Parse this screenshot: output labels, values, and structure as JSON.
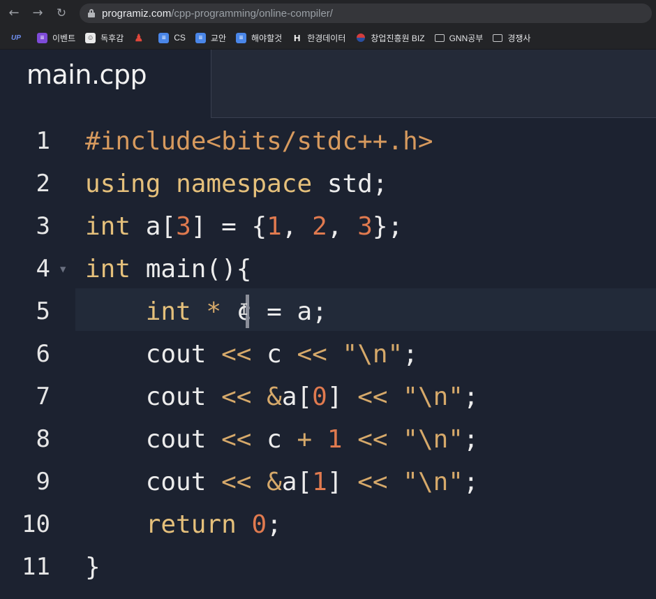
{
  "browser": {
    "back_icon": "back-arrow-icon",
    "forward_icon": "forward-arrow-icon",
    "reload_icon": "reload-icon",
    "url_host": "programiz.com",
    "url_path": "/cpp-programming/online-compiler/"
  },
  "bookmarks": [
    {
      "label": "",
      "icon": "up-icon"
    },
    {
      "label": "이벤트",
      "icon": "list-icon"
    },
    {
      "label": "독후감",
      "icon": "chat-icon"
    },
    {
      "label": "",
      "icon": "person-icon"
    },
    {
      "label": "CS",
      "icon": "doc-icon"
    },
    {
      "label": "교안",
      "icon": "doc-icon"
    },
    {
      "label": "해야할것",
      "icon": "doc-icon"
    },
    {
      "label": "한경데이터",
      "icon": "h-icon"
    },
    {
      "label": "창업진흥원 BIZ",
      "icon": "korea-icon"
    },
    {
      "label": "GNN공부",
      "icon": "folder-icon"
    },
    {
      "label": "경쟁사",
      "icon": "folder-icon"
    }
  ],
  "editor": {
    "tab_title": "main.cpp",
    "line_numbers": [
      "1",
      "2",
      "3",
      "4",
      "5",
      "6",
      "7",
      "8",
      "9",
      "10",
      "11"
    ],
    "lines": [
      [
        {
          "t": "#include",
          "c": "t-inc"
        },
        {
          "t": "<bits/stdc++.h>",
          "c": "t-inc"
        }
      ],
      [
        {
          "t": "using",
          "c": "t-kw"
        },
        {
          "t": " ",
          "c": "t-plain"
        },
        {
          "t": "namespace",
          "c": "t-kw"
        },
        {
          "t": " std;",
          "c": "t-plain"
        }
      ],
      [
        {
          "t": "int",
          "c": "t-kw"
        },
        {
          "t": " a[",
          "c": "t-plain"
        },
        {
          "t": "3",
          "c": "t-num"
        },
        {
          "t": "] = {",
          "c": "t-plain"
        },
        {
          "t": "1",
          "c": "t-num"
        },
        {
          "t": ", ",
          "c": "t-plain"
        },
        {
          "t": "2",
          "c": "t-num"
        },
        {
          "t": ", ",
          "c": "t-plain"
        },
        {
          "t": "3",
          "c": "t-num"
        },
        {
          "t": "};",
          "c": "t-plain"
        }
      ],
      [
        {
          "t": "int",
          "c": "t-kw"
        },
        {
          "t": " main(){",
          "c": "t-plain"
        }
      ],
      [
        {
          "t": "    ",
          "c": "t-plain"
        },
        {
          "t": "int",
          "c": "t-kw"
        },
        {
          "t": " * ",
          "c": "t-op"
        },
        {
          "t": "c = a;",
          "c": "t-plain"
        }
      ],
      [
        {
          "t": "    cout ",
          "c": "t-plain"
        },
        {
          "t": "<<",
          "c": "t-op"
        },
        {
          "t": " c ",
          "c": "t-plain"
        },
        {
          "t": "<<",
          "c": "t-op"
        },
        {
          "t": " ",
          "c": "t-plain"
        },
        {
          "t": "\"\\n\"",
          "c": "t-str"
        },
        {
          "t": ";",
          "c": "t-plain"
        }
      ],
      [
        {
          "t": "    cout ",
          "c": "t-plain"
        },
        {
          "t": "<<",
          "c": "t-op"
        },
        {
          "t": " ",
          "c": "t-plain"
        },
        {
          "t": "&",
          "c": "t-op"
        },
        {
          "t": "a[",
          "c": "t-plain"
        },
        {
          "t": "0",
          "c": "t-num"
        },
        {
          "t": "] ",
          "c": "t-plain"
        },
        {
          "t": "<<",
          "c": "t-op"
        },
        {
          "t": " ",
          "c": "t-plain"
        },
        {
          "t": "\"\\n\"",
          "c": "t-str"
        },
        {
          "t": ";",
          "c": "t-plain"
        }
      ],
      [
        {
          "t": "    cout ",
          "c": "t-plain"
        },
        {
          "t": "<<",
          "c": "t-op"
        },
        {
          "t": " c ",
          "c": "t-plain"
        },
        {
          "t": "+",
          "c": "t-op"
        },
        {
          "t": " ",
          "c": "t-plain"
        },
        {
          "t": "1",
          "c": "t-num"
        },
        {
          "t": " ",
          "c": "t-plain"
        },
        {
          "t": "<<",
          "c": "t-op"
        },
        {
          "t": " ",
          "c": "t-plain"
        },
        {
          "t": "\"\\n\"",
          "c": "t-str"
        },
        {
          "t": ";",
          "c": "t-plain"
        }
      ],
      [
        {
          "t": "    cout ",
          "c": "t-plain"
        },
        {
          "t": "<<",
          "c": "t-op"
        },
        {
          "t": " ",
          "c": "t-plain"
        },
        {
          "t": "&",
          "c": "t-op"
        },
        {
          "t": "a[",
          "c": "t-plain"
        },
        {
          "t": "1",
          "c": "t-num"
        },
        {
          "t": "] ",
          "c": "t-plain"
        },
        {
          "t": "<<",
          "c": "t-op"
        },
        {
          "t": " ",
          "c": "t-plain"
        },
        {
          "t": "\"\\n\"",
          "c": "t-str"
        },
        {
          "t": ";",
          "c": "t-plain"
        }
      ],
      [
        {
          "t": "    ",
          "c": "t-plain"
        },
        {
          "t": "return",
          "c": "t-kw"
        },
        {
          "t": " ",
          "c": "t-plain"
        },
        {
          "t": "0",
          "c": "t-num"
        },
        {
          "t": ";",
          "c": "t-plain"
        }
      ],
      [
        {
          "t": "}",
          "c": "t-plain"
        }
      ]
    ],
    "fold_icon": "fold-arrow-icon"
  }
}
